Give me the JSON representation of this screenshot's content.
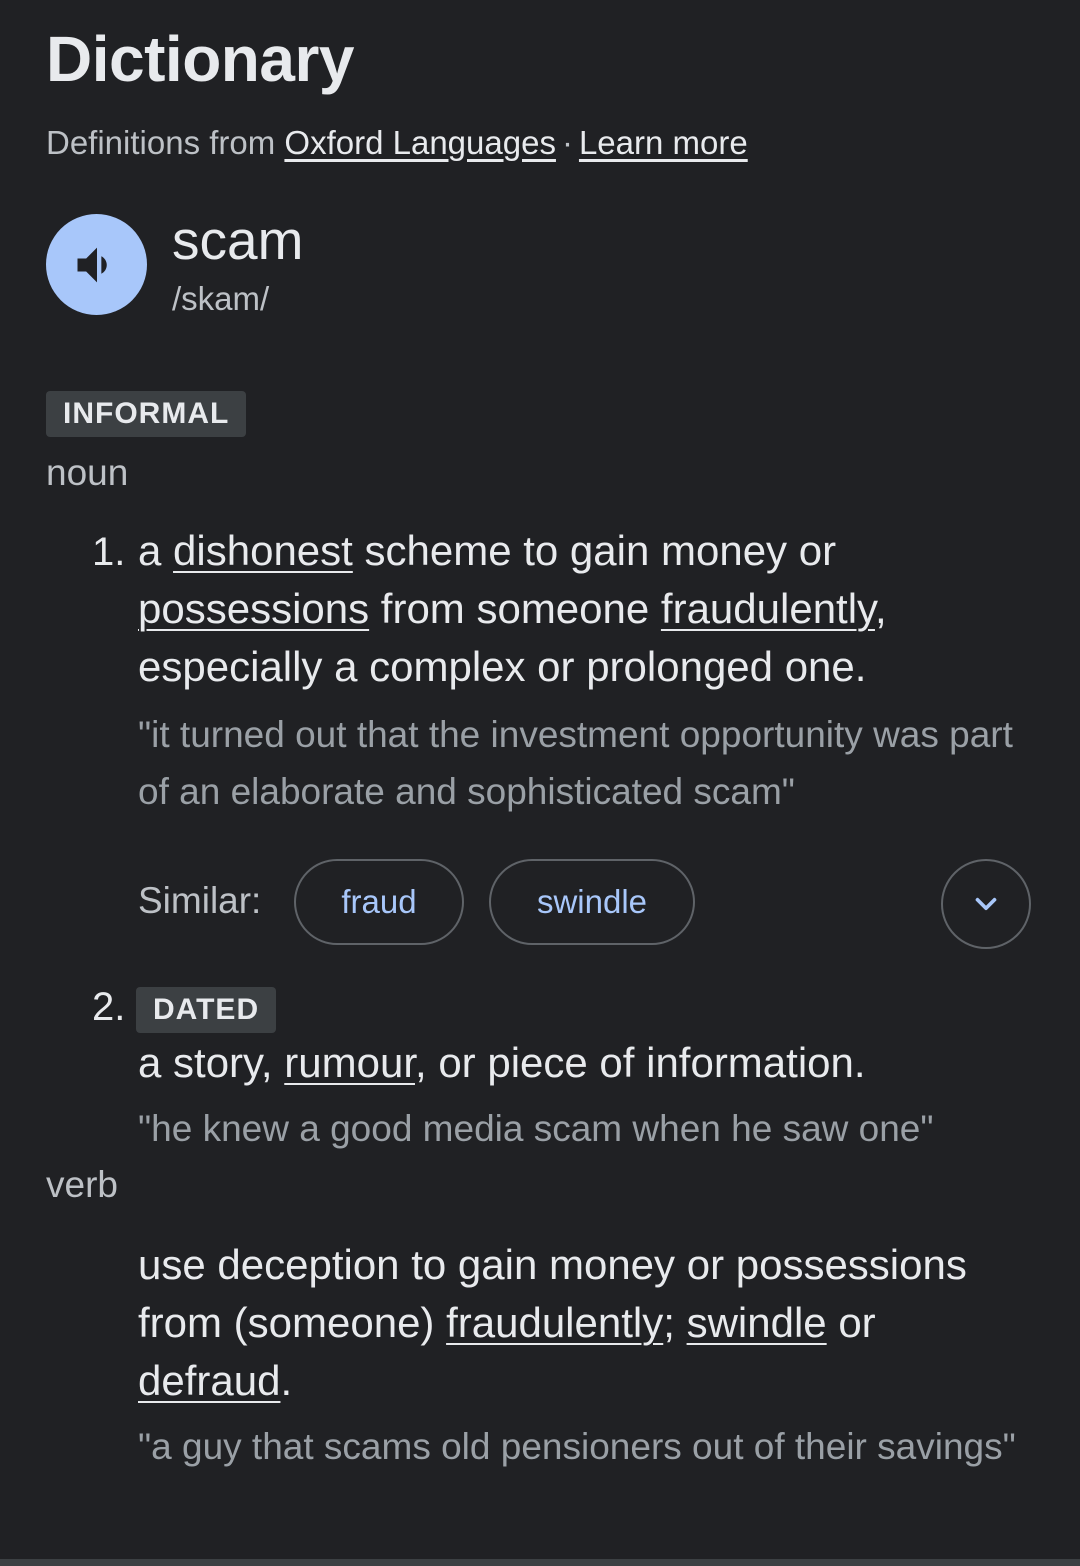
{
  "header": {
    "title": "Dictionary",
    "source_prefix": "Definitions from",
    "source_link": "Oxford Languages",
    "separator": "·",
    "learn_more": "Learn more"
  },
  "entry": {
    "word": "scam",
    "phonetic": "/skam/",
    "register_badge": "INFORMAL"
  },
  "noun": {
    "label": "noun",
    "senses": [
      {
        "number": "1.",
        "parts": [
          "a ",
          "dishonest",
          " scheme to gain money or ",
          "possessions",
          " from someone ",
          "fraudulently",
          ", especially a complex or prolonged one."
        ],
        "example": "\"it turned out that the investment opportunity was part of an elaborate and sophisticated scam\"",
        "similar_label": "Similar:",
        "similar": [
          "fraud",
          "swindle"
        ]
      },
      {
        "number": "2.",
        "badge": "DATED",
        "parts": [
          "a story, ",
          "rumour",
          ", or piece of information."
        ],
        "example": "\"he knew a good media scam when he saw one\""
      }
    ]
  },
  "verb": {
    "label": "verb",
    "parts": [
      "use deception to gain money or possessions from (someone) ",
      "fraudulently",
      "; ",
      "swindle",
      " or ",
      "defraud",
      "."
    ],
    "example": "\"a guy that scams old pensioners out of their savings\""
  },
  "icons": {
    "speaker": "volume-up-icon",
    "expand": "chevron-down-icon"
  },
  "colors": {
    "background": "#202124",
    "accent": "#a8c7fa"
  }
}
